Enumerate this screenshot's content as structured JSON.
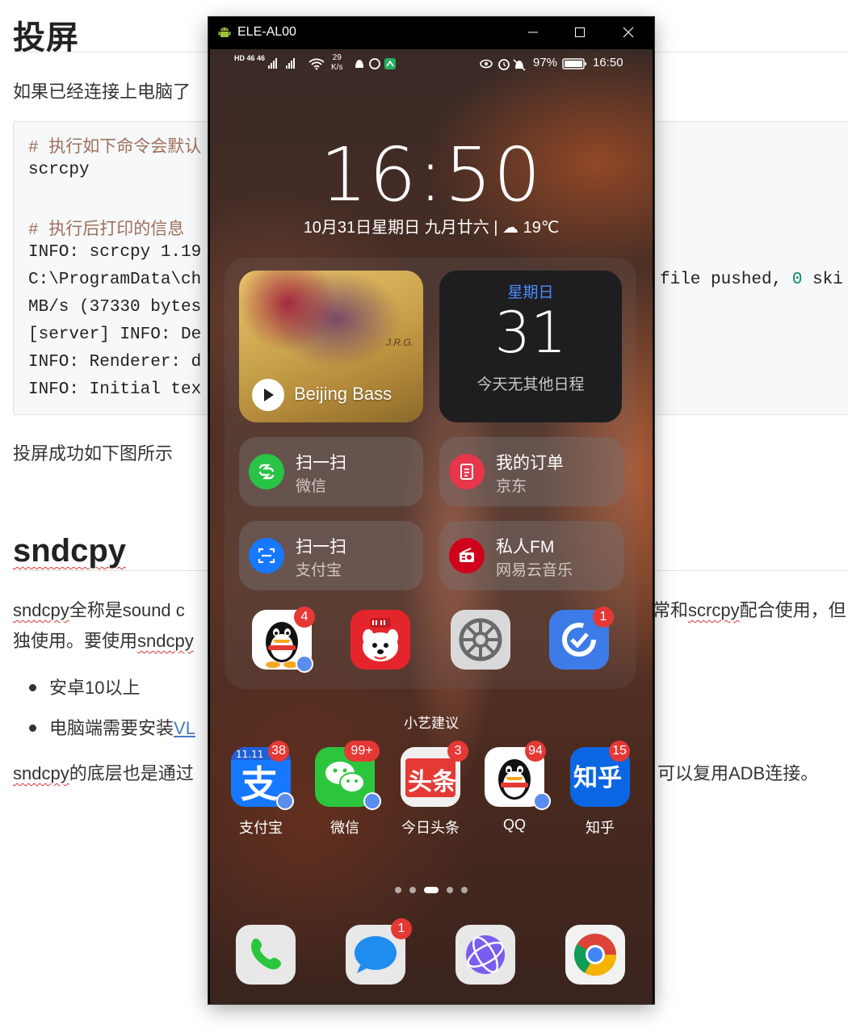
{
  "doc": {
    "h1": "投屏",
    "p1": "如果已经连接上电脑了",
    "code": {
      "c1": "# 执行如下命令会默认",
      "l2": "scrcpy",
      "c2": "# 执行后打印的信息",
      "l3": "INFO: scrcpy 1.19",
      "l4": "C:\\ProgramData\\ch",
      "l4b": "file pushed, ",
      "l4c": "0",
      "l4d": " ski",
      "l5": "MB/s (37330 bytes",
      "l6": "[server] INFO: De",
      "l7": "INFO: Renderer: d",
      "l8": "INFO: Initial tex"
    },
    "p2": "投屏成功如下图所示",
    "h2": "sndcpy",
    "p3a": "sndcpy",
    "p3b": "全称是sound c",
    "p3c": "常和",
    "p3d": "scrcpy",
    "p3e": "配合使用，但",
    "p4a": "独使用。要使用",
    "p4b": "sndcpy",
    "bullet1": "安卓10以上",
    "bullet2a": "电脑端需要安装",
    "bullet2b": "VL",
    "p5a": "sndcpy",
    "p5b": "的底层也是通过",
    "p5c": "可以复用ADB连接。"
  },
  "window": {
    "title": "ELE-AL00"
  },
  "status": {
    "left": "HD 46 46",
    "speed_top": "29",
    "speed_bottom": "K/s",
    "battery": "97%",
    "time": "16:50"
  },
  "lock": {
    "clock": "16:50",
    "date": "10月31日星期日  九月廿六  |  ☁ 19℃"
  },
  "music": {
    "title": "Beijing Bass",
    "art_text": "J.R.G."
  },
  "calendar": {
    "weekday": "星期日",
    "day": "31",
    "empty": "今天无其他日程"
  },
  "shortcuts": [
    {
      "line1": "扫一扫",
      "line2": "微信"
    },
    {
      "line1": "我的订单",
      "line2": "京东"
    },
    {
      "line1": "扫一扫",
      "line2": "支付宝"
    },
    {
      "line1": "私人FM",
      "line2": "网易云音乐"
    }
  ],
  "suggested": {
    "label": "小艺建议",
    "apps": [
      {
        "name": "qq-app",
        "badge": "4"
      },
      {
        "name": "jd-app",
        "badge": ""
      },
      {
        "name": "settings-app",
        "badge": ""
      },
      {
        "name": "clean-app",
        "badge": "1"
      }
    ]
  },
  "home_apps": [
    {
      "label": "支付宝",
      "badge": "38"
    },
    {
      "label": "微信",
      "badge": "99+"
    },
    {
      "label": "今日头条",
      "badge": "3"
    },
    {
      "label": "QQ",
      "badge": "94"
    },
    {
      "label": "知乎",
      "badge": "15"
    }
  ],
  "dock": {
    "messages_badge": "1"
  },
  "colors": {
    "accent_blue": "#4a8dff",
    "badge_red": "#e53935"
  }
}
